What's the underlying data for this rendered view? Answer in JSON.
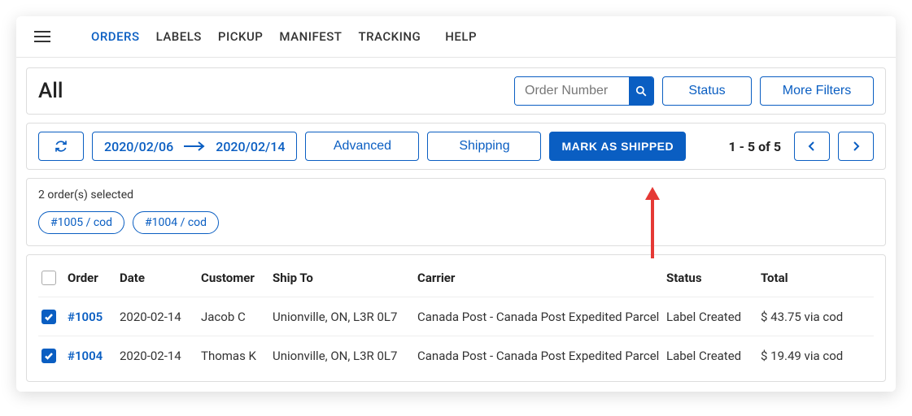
{
  "nav": {
    "items": [
      "ORDERS",
      "LABELS",
      "PICKUP",
      "MANIFEST",
      "TRACKING"
    ],
    "help": "HELP",
    "active_index": 0
  },
  "header": {
    "title": "All",
    "search_placeholder": "Order Number",
    "status_label": "Status",
    "more_filters_label": "More Filters"
  },
  "toolbar": {
    "date_from": "2020/02/06",
    "date_to": "2020/02/14",
    "advanced_label": "Advanced",
    "shipping_label": "Shipping",
    "mark_shipped_label": "MARK AS SHIPPED",
    "pagination_text": "1 - 5 of 5"
  },
  "selection": {
    "summary": "2 order(s) selected",
    "chips": [
      "#1005 / cod",
      "#1004 / cod"
    ]
  },
  "table": {
    "headers": [
      "Order",
      "Date",
      "Customer",
      "Ship To",
      "Carrier",
      "Status",
      "Total"
    ],
    "rows": [
      {
        "checked": true,
        "order": "#1005",
        "date": "2020-02-14",
        "customer": "Jacob C",
        "ship_to": "Unionville, ON, L3R 0L7",
        "carrier": "Canada Post - Canada Post Expedited Parcel",
        "status": "Label Created",
        "total": "$ 43.75 via cod"
      },
      {
        "checked": true,
        "order": "#1004",
        "date": "2020-02-14",
        "customer": "Thomas K",
        "ship_to": "Unionville, ON, L3R 0L7",
        "carrier": "Canada Post - Canada Post Expedited Parcel",
        "status": "Label Created",
        "total": "$ 19.49 via cod"
      }
    ]
  },
  "colors": {
    "accent": "#0a5ec2",
    "annotation": "#e53935"
  }
}
